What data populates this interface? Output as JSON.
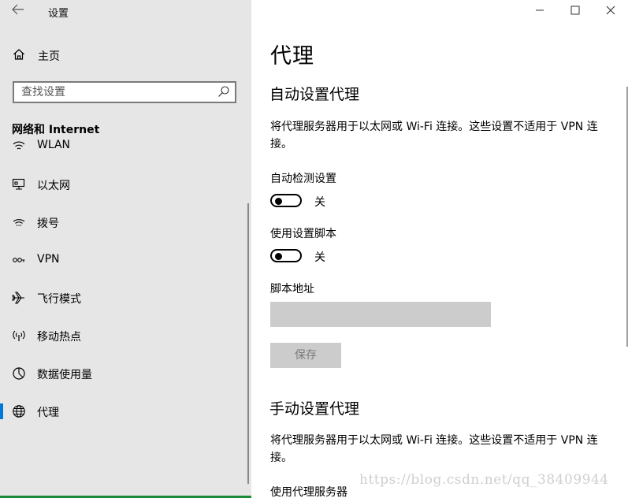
{
  "window": {
    "title": "设置",
    "back_icon": "back-arrow-icon",
    "minimize_icon": "minimize-icon",
    "maximize_icon": "maximize-icon",
    "close_icon": "close-icon"
  },
  "sidebar": {
    "home_label": "主页",
    "search_placeholder": "查找设置",
    "section_title": "网络和 Internet",
    "items": [
      {
        "label": "WLAN",
        "icon": "wifi-icon"
      },
      {
        "label": "以太网",
        "icon": "ethernet-icon"
      },
      {
        "label": "拨号",
        "icon": "dialup-icon"
      },
      {
        "label": "VPN",
        "icon": "vpn-icon"
      },
      {
        "label": "飞行模式",
        "icon": "airplane-icon"
      },
      {
        "label": "移动热点",
        "icon": "hotspot-icon"
      },
      {
        "label": "数据使用量",
        "icon": "data-usage-icon"
      },
      {
        "label": "代理",
        "icon": "globe-icon",
        "selected": true
      }
    ],
    "accent_color": "#0078d7"
  },
  "main": {
    "page_title": "代理",
    "auto": {
      "heading": "自动设置代理",
      "description": "将代理服务器用于以太网或 Wi-Fi 连接。这些设置不适用于 VPN 连接。",
      "detect_label": "自动检测设置",
      "detect_state": "关",
      "script_label": "使用设置脚本",
      "script_state": "关",
      "address_label": "脚本地址",
      "address_value": "",
      "save_label": "保存"
    },
    "manual": {
      "heading": "手动设置代理",
      "description": "将代理服务器用于以太网或 Wi-Fi 连接。这些设置不适用于 VPN 连接。",
      "use_proxy_label": "使用代理服务器"
    }
  },
  "watermark": "https://blog.csdn.net/qq_38409944"
}
